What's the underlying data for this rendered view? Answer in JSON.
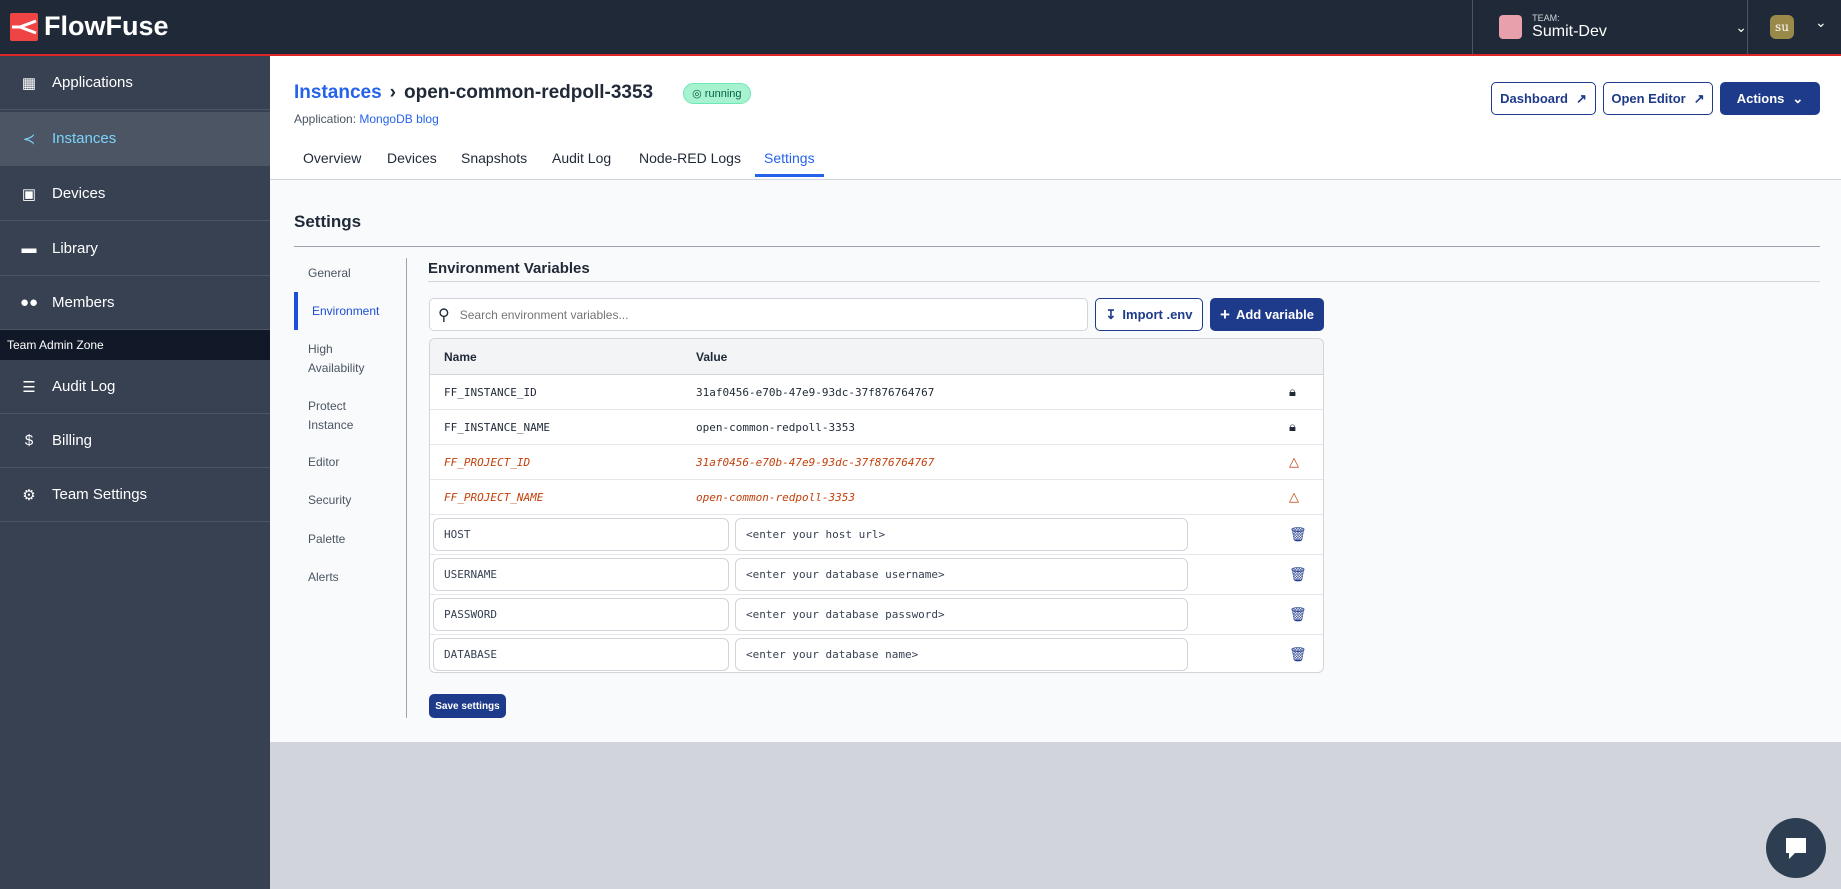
{
  "brand": {
    "name": "FlowFuse",
    "accent": "#ef4444"
  },
  "team": {
    "label": "TEAM:",
    "name": "Sumit-Dev"
  },
  "user": {
    "initials": "su"
  },
  "sidebar": {
    "items": [
      {
        "label": "Applications",
        "icon": "applications-icon"
      },
      {
        "label": "Instances",
        "icon": "instances-icon",
        "active": true
      },
      {
        "label": "Devices",
        "icon": "chip-icon"
      },
      {
        "label": "Library",
        "icon": "folder-icon"
      },
      {
        "label": "Members",
        "icon": "users-icon"
      }
    ],
    "admin_zone": "Team Admin Zone",
    "admin_items": [
      {
        "label": "Audit Log",
        "icon": "database-icon"
      },
      {
        "label": "Billing",
        "icon": "dollar-icon"
      },
      {
        "label": "Team Settings",
        "icon": "gear-icon"
      }
    ]
  },
  "header": {
    "breadcrumb_root": "Instances",
    "instance_name": "open-common-redpoll-3353",
    "status": "running",
    "application_label": "Application:",
    "application_name": "MongoDB blog",
    "buttons": {
      "dashboard": "Dashboard",
      "open_editor": "Open Editor",
      "actions": "Actions"
    }
  },
  "tabs": [
    "Overview",
    "Devices",
    "Snapshots",
    "Audit Log",
    "Node-RED Logs",
    "Settings"
  ],
  "active_tab": "Settings",
  "settings": {
    "title": "Settings",
    "nav": [
      "General",
      "Environment",
      "High Availability",
      "Protect Instance",
      "Editor",
      "Security",
      "Palette",
      "Alerts"
    ],
    "active_nav": "Environment"
  },
  "env": {
    "title": "Environment Variables",
    "search_placeholder": "Search environment variables...",
    "import_label": "Import .env",
    "add_label": "Add variable",
    "columns": {
      "name": "Name",
      "value": "Value"
    },
    "readonly": [
      {
        "name": "FF_INSTANCE_ID",
        "value": "31af0456-e70b-47e9-93dc-37f876764767",
        "icon": "lock-icon"
      },
      {
        "name": "FF_INSTANCE_NAME",
        "value": "open-common-redpoll-3353",
        "icon": "lock-icon"
      },
      {
        "name": "FF_PROJECT_ID",
        "value": "31af0456-e70b-47e9-93dc-37f876764767",
        "icon": "warning-icon"
      },
      {
        "name": "FF_PROJECT_NAME",
        "value": "open-common-redpoll-3353",
        "icon": "warning-icon"
      }
    ],
    "editable": [
      {
        "name": "HOST",
        "value": "<enter your host url>"
      },
      {
        "name": "USERNAME",
        "value": "<enter your database username>"
      },
      {
        "name": "PASSWORD",
        "value": "<enter your database password>"
      },
      {
        "name": "DATABASE",
        "value": "<enter your database name>"
      }
    ],
    "save_label": "Save settings"
  }
}
